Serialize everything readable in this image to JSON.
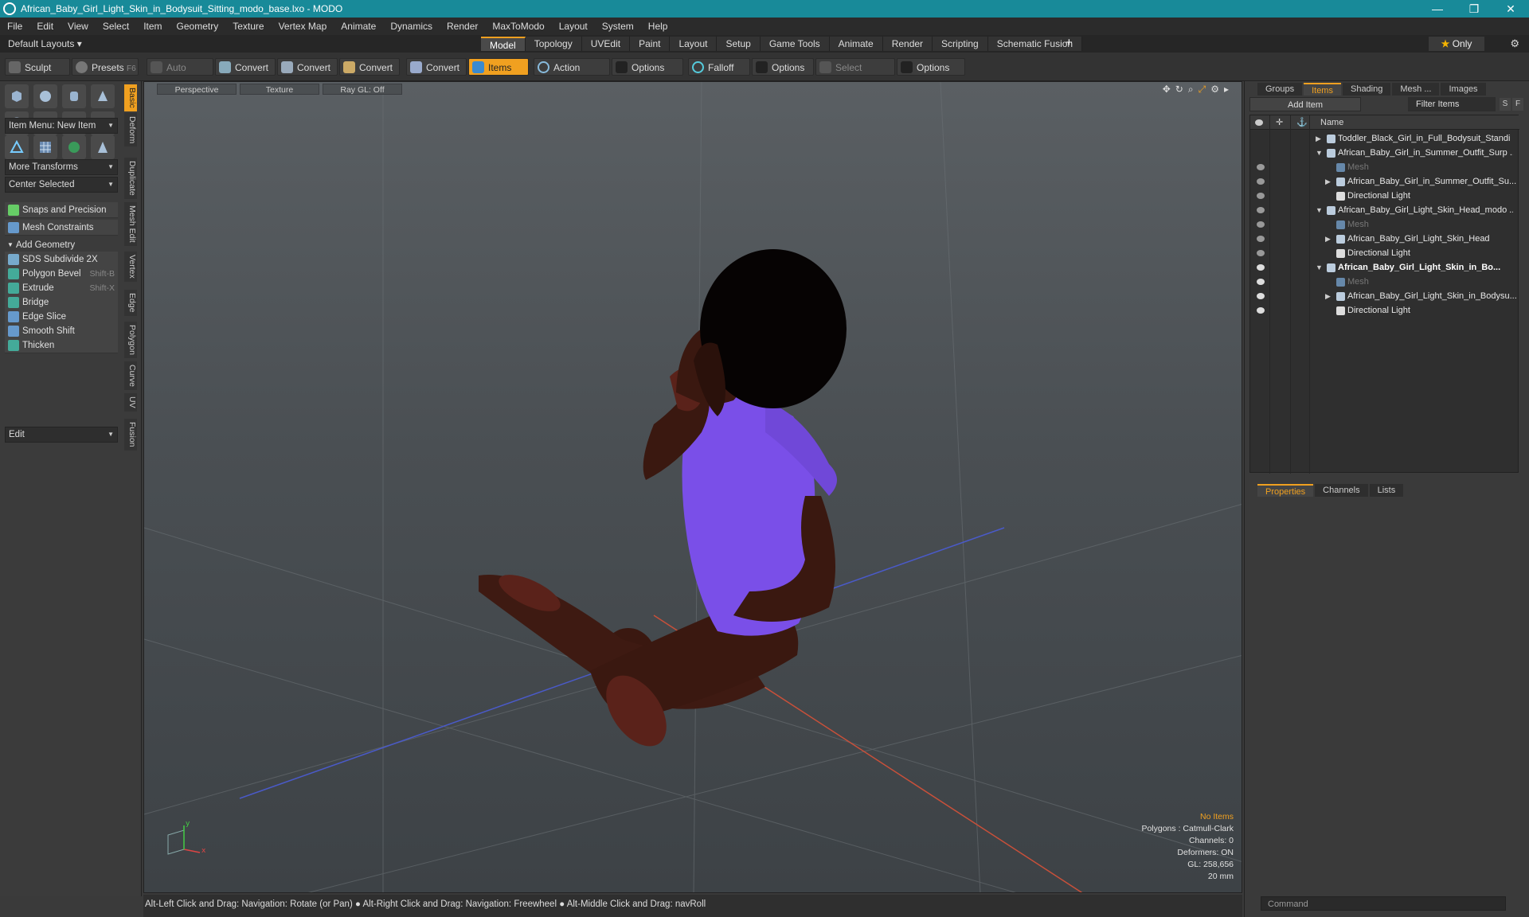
{
  "window": {
    "title": "African_Baby_Girl_Light_Skin_in_Bodysuit_Sitting_modo_base.lxo - MODO"
  },
  "menu": [
    "File",
    "Edit",
    "View",
    "Select",
    "Item",
    "Geometry",
    "Texture",
    "Vertex Map",
    "Animate",
    "Dynamics",
    "Render",
    "MaxToModo",
    "Layout",
    "System",
    "Help"
  ],
  "layout": {
    "default_layouts": "Default Layouts ▾",
    "tabs": [
      "Model",
      "Topology",
      "UVEdit",
      "Paint",
      "Layout",
      "Setup",
      "Game Tools",
      "Animate",
      "Render",
      "Scripting",
      "Schematic Fusion"
    ],
    "active_tab": "Model",
    "only": "Only"
  },
  "toolbar": {
    "sculpt": "Sculpt",
    "presets": "Presets",
    "presets_key": "F6",
    "auto_select": "Auto Select",
    "convert1": "Convert",
    "convert2": "Convert",
    "convert3": "Convert",
    "convert4": "Convert",
    "items": "Items",
    "action_center": "Action Center",
    "options1": "Options",
    "falloff": "Falloff",
    "options2": "Options",
    "select_through": "Select Through",
    "options3": "Options"
  },
  "left": {
    "item_menu": "Item Menu: New Item",
    "more_transforms": "More Transforms",
    "center_selected": "Center Selected",
    "snaps": "Snaps and Precision",
    "mesh_constraints": "Mesh Constraints",
    "add_geometry": "Add Geometry",
    "tools": [
      {
        "label": "SDS Subdivide 2X",
        "shortcut": ""
      },
      {
        "label": "Polygon Bevel",
        "shortcut": "Shift-B"
      },
      {
        "label": "Extrude",
        "shortcut": "Shift-X"
      },
      {
        "label": "Bridge",
        "shortcut": ""
      },
      {
        "label": "Edge Slice",
        "shortcut": ""
      },
      {
        "label": "Smooth Shift",
        "shortcut": ""
      },
      {
        "label": "Thicken",
        "shortcut": ""
      }
    ],
    "edit": "Edit",
    "vtabs": [
      "Basic",
      "Deform",
      "Duplicate",
      "Mesh Edit",
      "Vertex",
      "Edge",
      "Polygon",
      "Curve",
      "UV",
      "Fusion"
    ]
  },
  "viewport": {
    "perspective": "Perspective",
    "texture": "Texture",
    "raygl": "Ray GL: Off",
    "stats": {
      "no_items": "No Items",
      "polygons": "Polygons : Catmull-Clark",
      "channels": "Channels: 0",
      "deformers": "Deformers: ON",
      "gl": "GL: 258,656",
      "size": "20 mm"
    }
  },
  "status": "Alt-Left Click and Drag: Navigation: Rotate (or Pan) ● Alt-Right Click and Drag: Navigation: Freewheel ● Alt-Middle Click and Drag: navRoll",
  "right": {
    "tabs": [
      "Groups",
      "Items",
      "Shading",
      "Mesh ...",
      "Images"
    ],
    "active_tab": "Items",
    "add_item": "Add Item",
    "filter_items": "Filter Items",
    "s": "S",
    "f": "F",
    "col_name": "Name",
    "items": [
      {
        "label": "Toddler_Black_Girl_in_Full_Bodysuit_Standi ...",
        "level": 0,
        "arrow": "▶",
        "style": "normal",
        "eye": false
      },
      {
        "label": "African_Baby_Girl_in_Summer_Outfit_Surp ...",
        "level": 0,
        "arrow": "▼",
        "style": "normal",
        "eye": false
      },
      {
        "label": "Mesh",
        "level": 1,
        "arrow": "",
        "style": "grey",
        "eye": true
      },
      {
        "label": "African_Baby_Girl_in_Summer_Outfit_Su...",
        "level": 1,
        "arrow": "▶",
        "style": "normal",
        "eye": true
      },
      {
        "label": "Directional Light",
        "level": 1,
        "arrow": "",
        "style": "normal",
        "eye": true
      },
      {
        "label": "African_Baby_Girl_Light_Skin_Head_modo ...",
        "level": 0,
        "arrow": "▼",
        "style": "normal",
        "eye": false
      },
      {
        "label": "Mesh",
        "level": 1,
        "arrow": "",
        "style": "grey",
        "eye": true
      },
      {
        "label": "African_Baby_Girl_Light_Skin_Head",
        "level": 1,
        "arrow": "▶",
        "style": "normal",
        "eye": true
      },
      {
        "label": "Directional Light",
        "level": 1,
        "arrow": "",
        "style": "normal",
        "eye": true
      },
      {
        "label": "African_Baby_Girl_Light_Skin_in_Bo...",
        "level": 0,
        "arrow": "▼",
        "style": "bold",
        "eye": true
      },
      {
        "label": "Mesh",
        "level": 1,
        "arrow": "",
        "style": "grey",
        "eye": true
      },
      {
        "label": "African_Baby_Girl_Light_Skin_in_Bodysu...",
        "level": 1,
        "arrow": "▶",
        "style": "normal",
        "eye": true
      },
      {
        "label": "Directional Light",
        "level": 1,
        "arrow": "",
        "style": "normal",
        "eye": true
      }
    ],
    "ptabs": [
      "Properties",
      "Channels",
      "Lists"
    ],
    "active_ptab": "Properties",
    "command": "Command"
  },
  "colors": {
    "accent": "#f0a020",
    "title": "#188a99",
    "bodysuit": "#7a4fe8",
    "skin": "#3a1a12"
  }
}
